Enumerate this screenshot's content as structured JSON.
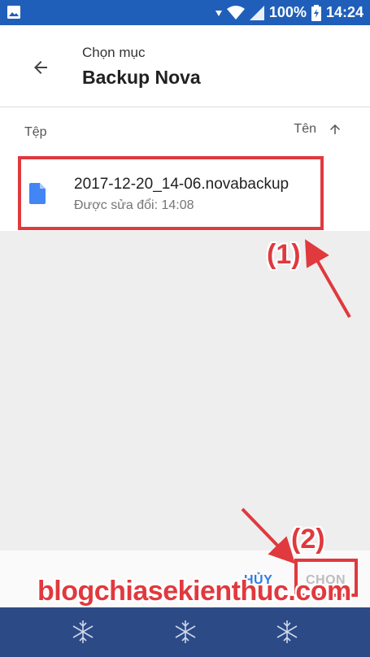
{
  "status_bar": {
    "battery": "100%",
    "time": "14:24",
    "icons": [
      "image-icon",
      "signal-down-icon",
      "wifi-icon",
      "cell-signal-icon",
      "battery-charging-icon"
    ]
  },
  "header": {
    "subtitle": "Chọn mục",
    "title": "Backup Nova"
  },
  "columns": {
    "type_label": "Tệp",
    "name_label": "Tên"
  },
  "files": [
    {
      "name": "2017-12-20_14-06.novabackup",
      "meta": "Được sửa đổi: 14:08"
    }
  ],
  "actions": {
    "cancel_label": "HỦY",
    "choose_label": "CHỌN"
  },
  "annotations": {
    "label_1": "(1)",
    "label_2": "(2)",
    "color": "#e0393e"
  },
  "watermark": "blogchiasekienthuc.com",
  "colors": {
    "status_bar": "#1f5fb9",
    "accent": "#2f7de1",
    "bottom_bar": "#2c4a86",
    "file_icon": "#4285f4"
  }
}
